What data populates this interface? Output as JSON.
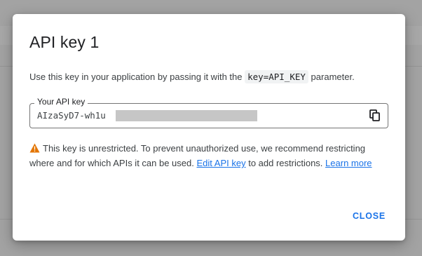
{
  "dialog": {
    "title": "API key 1",
    "description_prefix": "Use this key in your application by passing it with the",
    "description_code": "key=API_KEY",
    "description_suffix": "parameter.",
    "key_field_label": "Your API key",
    "key_value_visible": "AIzaSyD7-wh1u",
    "warning_text_1": "This key is unrestricted. To prevent unauthorized use, we recommend restricting where and for which APIs it can be used.",
    "edit_link": "Edit API key",
    "warning_text_2": "to add restrictions.",
    "learn_more_link": "Learn more",
    "close_label": "CLOSE"
  },
  "icons": {
    "copy": "copy-icon",
    "warning": "warning-icon"
  },
  "colors": {
    "accent": "#1a73e8",
    "warning": "#e37400",
    "scrim": "#a3a3a3"
  }
}
